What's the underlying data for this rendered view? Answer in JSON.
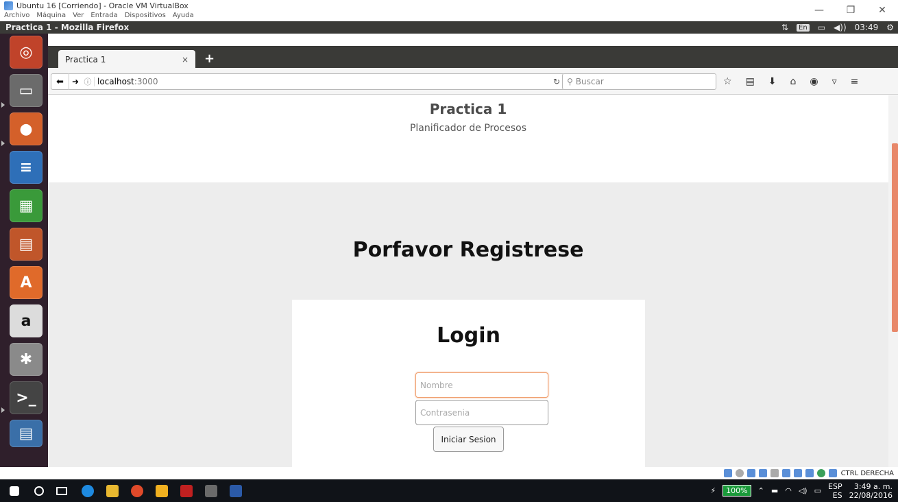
{
  "host_window": {
    "title": "Ubuntu 16 [Corriendo] - Oracle VM VirtualBox",
    "menu": [
      "Archivo",
      "Máquina",
      "Ver",
      "Entrada",
      "Dispositivos",
      "Ayuda"
    ]
  },
  "ubuntu_panel": {
    "window_title": "Practica 1 - Mozilla Firefox",
    "keyboard_lang": "En",
    "time": "03:49"
  },
  "firefox": {
    "tab": {
      "title": "Practica 1",
      "close": "×"
    },
    "new_tab": "+",
    "url": "localhost:3000",
    "url_host": "localhost",
    "url_port": ":3000",
    "search_placeholder": "Buscar"
  },
  "page": {
    "header_title": "Practica 1",
    "header_subtitle": "Planificador de Procesos",
    "register_title": "Porfavor Registrese",
    "login": {
      "title": "Login",
      "name_placeholder": "Nombre",
      "password_placeholder": "Contrasenia",
      "submit_label": "Iniciar Sesion"
    }
  },
  "vbox_status": {
    "host_key": "CTRL DERECHA"
  },
  "windows_tray": {
    "battery": "100%",
    "lang_top": "ESP",
    "lang_bottom": "ES",
    "time": "3:49 a. m.",
    "date": "22/08/2016"
  },
  "colors": {
    "accent": "#e8886a",
    "launcher_bg": "#2f1f2b",
    "panel_bg": "#3a3a37"
  }
}
